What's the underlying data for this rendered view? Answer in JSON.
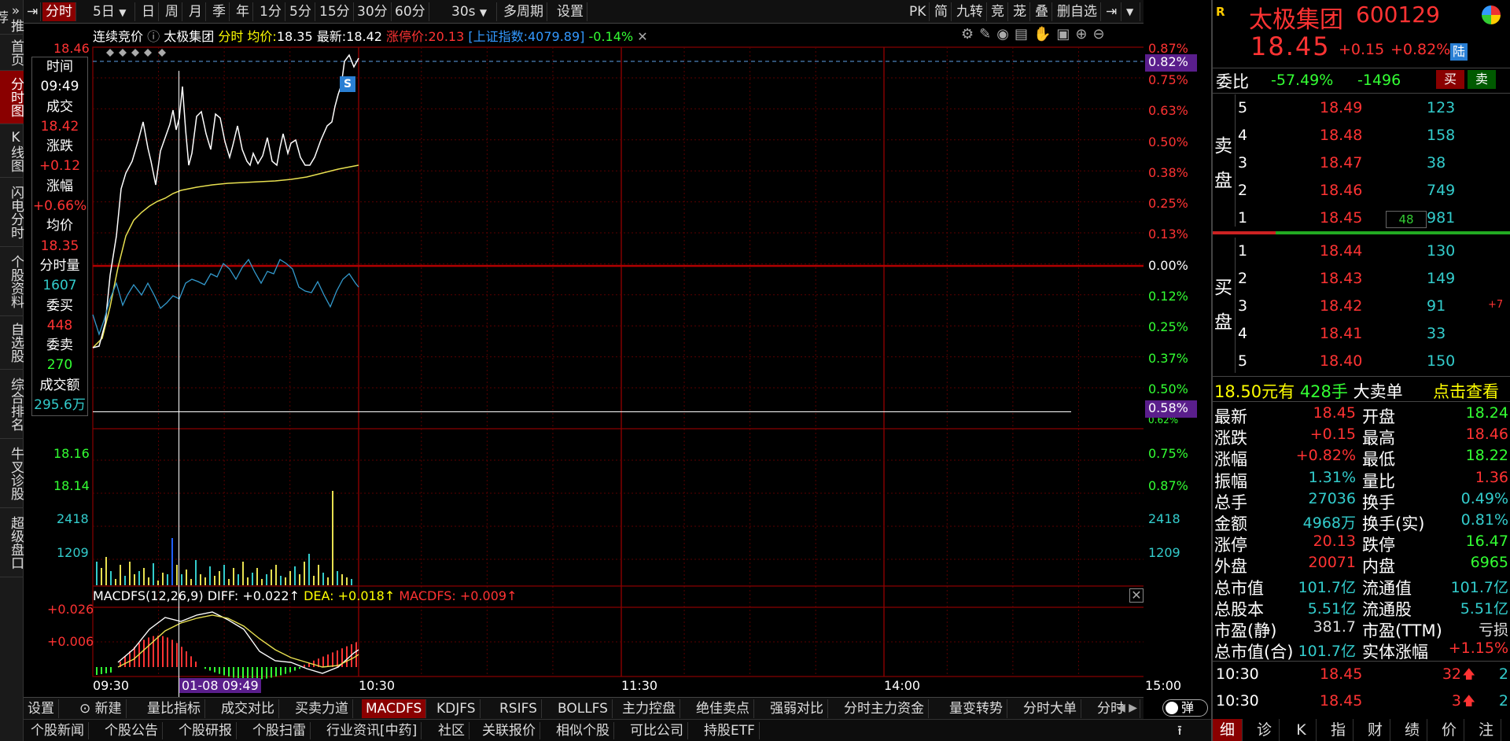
{
  "leftnav": [
    "推荐",
    "首页",
    "分时图",
    "K线图",
    "闪电分时",
    "个股资料",
    "自选股",
    "综合排名",
    "牛叉诊股",
    "超级盘口"
  ],
  "toolbar": {
    "left": [
      "分时",
      "5日",
      "日",
      "周",
      "月",
      "季",
      "年",
      "1分",
      "5分",
      "15分",
      "30分",
      "60分",
      "30s",
      "多周期",
      "设置"
    ],
    "right": [
      "PK",
      "简",
      "九转",
      "竞",
      "茏",
      "叠",
      "删自选"
    ]
  },
  "chart_header": {
    "session": "连续竞价",
    "name": "太极集团",
    "mode": "分时",
    "avg_label": "均价:",
    "avg": "18.35",
    "last_label": "最新:",
    "last": "18.42",
    "limit_label": "涨停价:",
    "limit": "20.13",
    "index_label": "[上证指数:",
    "index": "4079.89]",
    "index_pct": "-0.14%"
  },
  "infobox": [
    {
      "label": "时间",
      "value": "09:49",
      "color": "#ffffff"
    },
    {
      "label": "成交",
      "value": "18.42",
      "color": "#ff3333"
    },
    {
      "label": "涨跌",
      "value": "+0.12",
      "color": "#ff3333"
    },
    {
      "label": "涨幅",
      "value": "+0.66%",
      "color": "#ff3333"
    },
    {
      "label": "均价",
      "value": "18.35",
      "color": "#ff3333"
    },
    {
      "label": "分时量",
      "value": "1607",
      "color": "#33cccc"
    },
    {
      "label": "委买",
      "value": "448",
      "color": "#ff3333"
    },
    {
      "label": "委卖",
      "value": "270",
      "color": "#33ff33"
    },
    {
      "label": "成交额",
      "value": "295.6万",
      "color": "#33cccc"
    }
  ],
  "axes": {
    "left_price": [
      "18.46",
      "18.16",
      "18.14",
      "2418",
      "1209"
    ],
    "left_macd": [
      "+0.026",
      "+0.006"
    ],
    "right_pct": [
      "0.87%",
      "0.82%",
      "0.75%",
      "0.63%",
      "0.50%",
      "0.38%",
      "0.25%",
      "0.13%",
      "0.00%",
      "0.12%",
      "0.25%",
      "0.37%",
      "0.50%",
      "0.58%",
      "0.62%",
      "0.75%",
      "0.87%",
      "2418",
      "1209"
    ],
    "time": [
      "09:30",
      "01-08 09:49",
      "10:30",
      "11:30",
      "14:00",
      "15:00"
    ]
  },
  "macd_header": {
    "title": "MACDFS(12,26,9)",
    "diff": "DIFF: +0.022↑",
    "dea": "DEA: +0.018↑",
    "macdfs": "MACDFS: +0.009↑"
  },
  "marker": "S",
  "btabs": [
    "设置",
    "新建",
    "量比指标",
    "成交对比",
    "买卖力道",
    "MACDFS",
    "KDJFS",
    "RSIFS",
    "BOLLFS",
    "主力控盘",
    "绝佳卖点",
    "强弱对比",
    "分时主力资金",
    "量变转势",
    "分时大单",
    "分时"
  ],
  "btoggle": "弹",
  "ntabs": [
    "个股新闻",
    "个股公告",
    "个股研报",
    "个股扫雷",
    "行业资讯[中药]",
    "社区",
    "关联报价",
    "相似个股",
    "可比公司",
    "持股ETF"
  ],
  "quote": {
    "badge": "R",
    "name": "太极集团",
    "code": "600129",
    "price": "18.45",
    "change": "+0.15",
    "pct": "+0.82%",
    "market": "陆",
    "weibi_label": "委比",
    "weibi": "-57.49%",
    "weicha": "-1496",
    "buy": "买",
    "sell": "卖",
    "sell_label": "卖盘",
    "buy_label": "买盘",
    "asks": [
      {
        "lv": "5",
        "price": "18.49",
        "vol": "123",
        "extra": ""
      },
      {
        "lv": "4",
        "price": "18.48",
        "vol": "158",
        "extra": ""
      },
      {
        "lv": "3",
        "price": "18.47",
        "vol": "38",
        "extra": ""
      },
      {
        "lv": "2",
        "price": "18.46",
        "vol": "749",
        "extra": ""
      },
      {
        "lv": "1",
        "price": "18.45",
        "vol": "981",
        "extra": "48"
      }
    ],
    "bids": [
      {
        "lv": "1",
        "price": "18.44",
        "vol": "130",
        "extra": ""
      },
      {
        "lv": "2",
        "price": "18.43",
        "vol": "149",
        "extra": ""
      },
      {
        "lv": "3",
        "price": "18.42",
        "vol": "91",
        "extra": "+7"
      },
      {
        "lv": "4",
        "price": "18.41",
        "vol": "33",
        "extra": ""
      },
      {
        "lv": "5",
        "price": "18.40",
        "vol": "150",
        "extra": ""
      }
    ],
    "bigorder": {
      "price": "18.50元有",
      "vol": "428手",
      "label": "大卖单",
      "link": "点击查看"
    },
    "stats": [
      {
        "l1": "最新",
        "v1": "18.45",
        "c1": "#ff3333",
        "l2": "开盘",
        "v2": "18.24",
        "c2": "#33ff33"
      },
      {
        "l1": "涨跌",
        "v1": "+0.15",
        "c1": "#ff3333",
        "l2": "最高",
        "v2": "18.46",
        "c2": "#ff3333"
      },
      {
        "l1": "涨幅",
        "v1": "+0.82%",
        "c1": "#ff3333",
        "l2": "最低",
        "v2": "18.22",
        "c2": "#33ff33"
      },
      {
        "l1": "振幅",
        "v1": "1.31%",
        "c1": "#33cccc",
        "l2": "量比",
        "v2": "1.36",
        "c2": "#ff3333"
      },
      {
        "l1": "总手",
        "v1": "27036",
        "c1": "#33cccc",
        "l2": "换手",
        "v2": "0.49%",
        "c2": "#33cccc"
      },
      {
        "l1": "金额",
        "v1": "4968万",
        "c1": "#33cccc",
        "l2": "换手(实)",
        "v2": "0.81%",
        "c2": "#33cccc"
      },
      {
        "l1": "涨停",
        "v1": "20.13",
        "c1": "#ff3333",
        "l2": "跌停",
        "v2": "16.47",
        "c2": "#33ff33"
      },
      {
        "l1": "外盘",
        "v1": "20071",
        "c1": "#ff3333",
        "l2": "内盘",
        "v2": "6965",
        "c2": "#33ff33"
      },
      {
        "l1": "总市值",
        "v1": "101.7亿",
        "c1": "#33cccc",
        "l2": "流通值",
        "v2": "101.7亿",
        "c2": "#33cccc"
      },
      {
        "l1": "总股本",
        "v1": "5.51亿",
        "c1": "#33cccc",
        "l2": "流通股",
        "v2": "5.51亿",
        "c2": "#33cccc"
      },
      {
        "l1": "市盈(静)",
        "v1": "381.7",
        "c1": "#dddddd",
        "l2": "市盈(TTM)",
        "v2": "亏损",
        "c2": "#dddddd"
      },
      {
        "l1": "总市值(合)",
        "v1": "101.7亿",
        "c1": "#33cccc",
        "l2": "实体涨幅",
        "v2": "+1.15%",
        "c2": "#ff3333"
      }
    ],
    "ticks": [
      {
        "time": "10:30",
        "price": "18.45",
        "vol": "32",
        "dir": "🡅",
        "n": "2"
      },
      {
        "time": "10:30",
        "price": "18.45",
        "vol": "3",
        "dir": "🡅",
        "n": "2"
      }
    ],
    "bottom_tabs": [
      "细",
      "诊",
      "K",
      "指",
      "财",
      "绩",
      "价",
      "注"
    ]
  }
}
